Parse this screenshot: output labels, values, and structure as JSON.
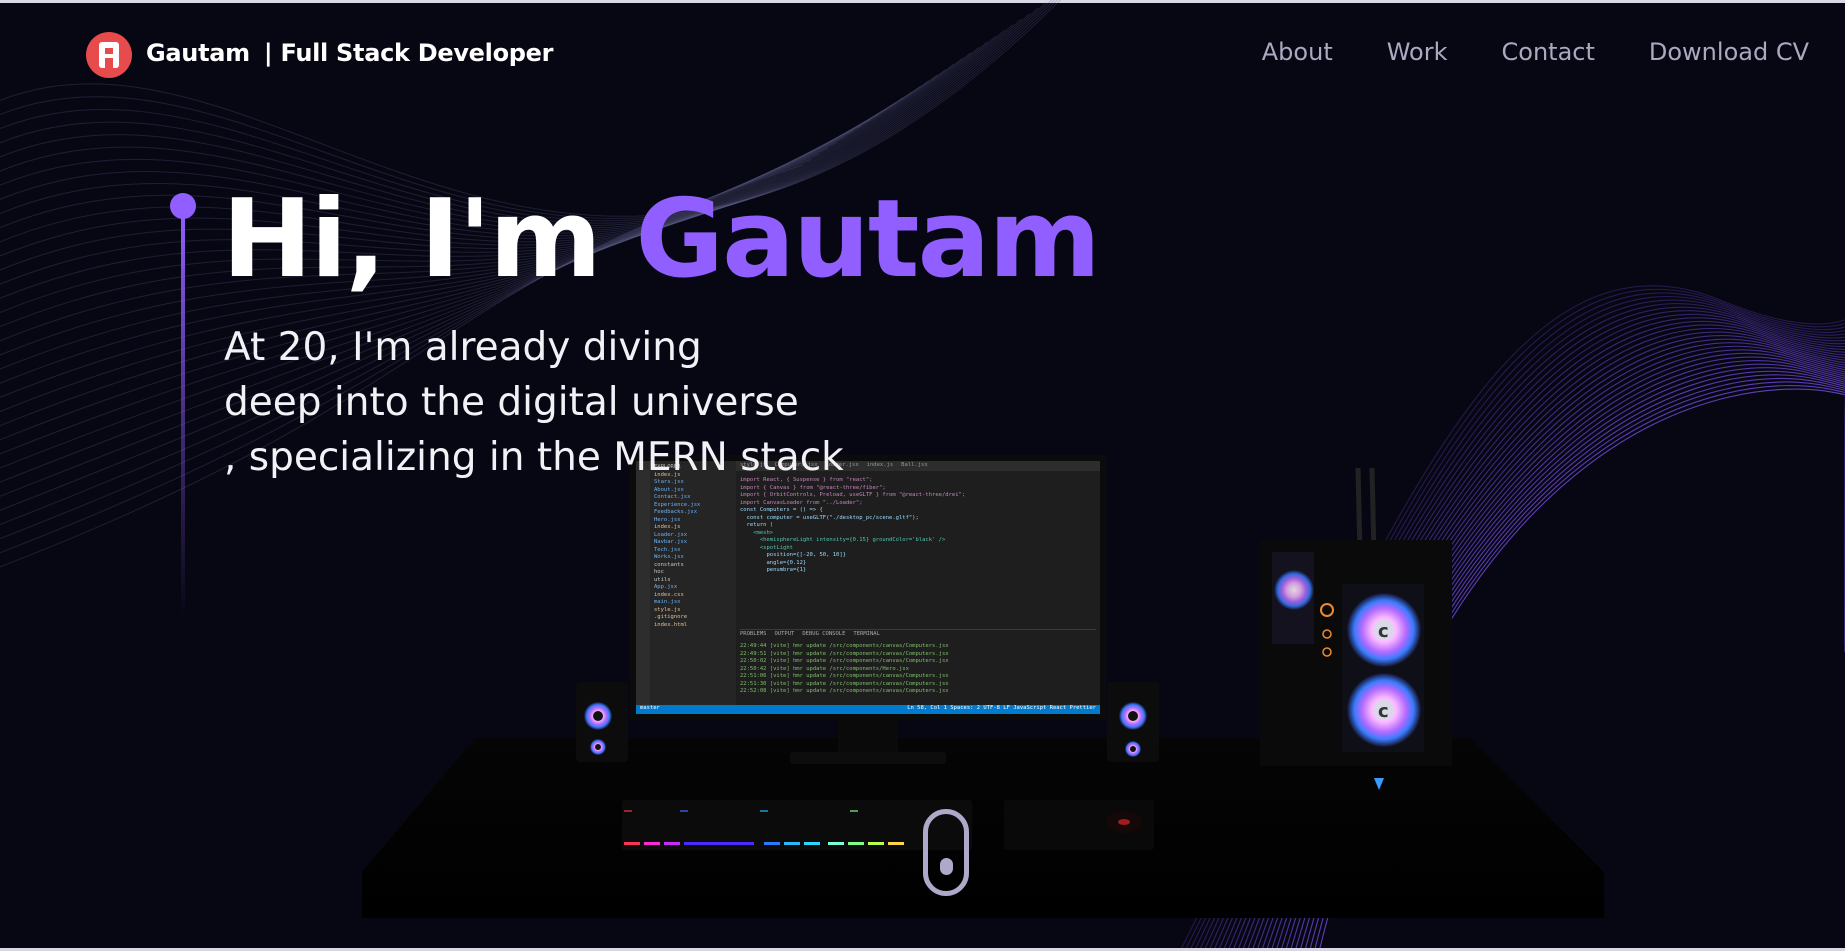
{
  "brand": {
    "name": "Gautam",
    "tagline": "| Full Stack Developer",
    "logo_icon": "logo-icon",
    "logo_color": "#e84b4b"
  },
  "nav": {
    "items": [
      {
        "label": "About"
      },
      {
        "label": "Work"
      },
      {
        "label": "Contact"
      },
      {
        "label": "Download CV"
      }
    ]
  },
  "hero": {
    "greeting": "Hi, I'm ",
    "name": "Gautam",
    "subtitle_lines": [
      "At 20, I'm already diving",
      "deep into the digital universe",
      ", specializing in the MERN stack"
    ],
    "accent_color": "#915eff"
  },
  "editor": {
    "explorer_title": "EXPLORER",
    "tabs": [
      "style.js",
      "Computers.jsx",
      "Loader.jsx",
      "index.js",
      "Ball.jsx"
    ],
    "code_lines": [
      "import React, { Suspense } from \"react\";",
      "import { Canvas } from \"@react-three/fiber\";",
      "import { OrbitControls, Preload, useGLTF } from \"@react-three/drei\";",
      "",
      "import CanvasLoader from \"../Loader\";",
      "",
      "const Computers = () => {",
      "  const computer = useGLTF(\"./desktop_pc/scene.gltf\");",
      "",
      "  return (",
      "    <mesh>",
      "      <hemisphereLight intensity={0.15} groundColor='black' />",
      "      <spotLight",
      "        position={[-20, 50, 10]}",
      "        angle={0.12}",
      "        penumbra={1}"
    ],
    "files": [
      "index.js",
      "Stars.jsx",
      "About.jsx",
      "Contact.jsx",
      "Experience.jsx",
      "Feedbacks.jsx",
      "Hero.jsx",
      "index.js",
      "Loader.jsx",
      "Navbar.jsx",
      "Tech.jsx",
      "Works.jsx",
      "constants",
      "hoc",
      "utils",
      "App.jsx",
      "index.css",
      "main.jsx",
      "style.js",
      ".gitignore",
      "index.html"
    ],
    "panel_tabs": [
      "PROBLEMS",
      "OUTPUT",
      "DEBUG CONSOLE",
      "TERMINAL"
    ],
    "terminal_lines": [
      "22:49:44 [vite] hmr update /src/components/canvas/Computers.jsx",
      "22:49:51 [vite] hmr update /src/components/canvas/Computers.jsx",
      "22:50:02 [vite] hmr update /src/components/canvas/Computers.jsx",
      "22:50:42 [vite] hmr update /src/components/Hero.jsx",
      "22:51:06 [vite] hmr update /src/components/canvas/Computers.jsx",
      "22:51:30 [vite] hmr update /src/components/canvas/Computers.jsx",
      "22:52:08 [vite] hmr update /src/components/canvas/Computers.jsx"
    ],
    "status_left": "master",
    "status_right": "Ln 58, Col 1   Spaces: 2   UTF-8   LF   JavaScript React   Prettier"
  },
  "scroll_indicator_icon": "mouse-scroll-icon"
}
